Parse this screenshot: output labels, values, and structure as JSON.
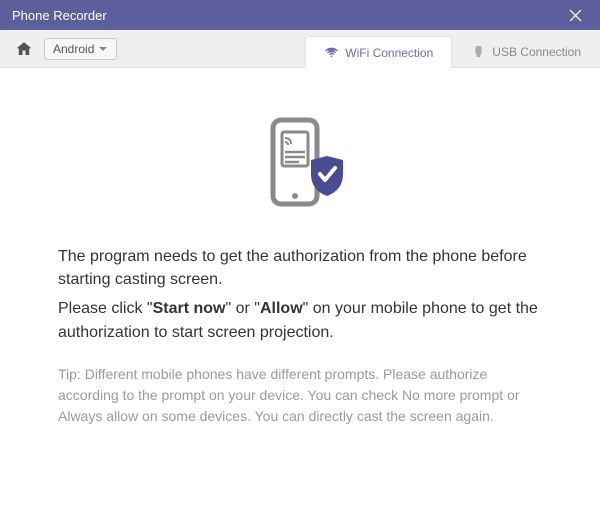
{
  "titlebar": {
    "title": "Phone Recorder"
  },
  "toolbar": {
    "device_label": "Android"
  },
  "tabs": {
    "wifi": "WiFi Connection",
    "usb": "USB Connection"
  },
  "messages": {
    "line1": "The program needs to get the authorization from the phone before starting casting screen.",
    "line2_pre": "Please click \"",
    "line2_b1": "Start now",
    "line2_mid": "\" or \"",
    "line2_b2": "Allow",
    "line2_post": "\" on your mobile phone to get the authorization to start screen projection.",
    "tip": "Tip: Different mobile phones have different prompts. Please authorize according to the prompt on your device. You can check No more prompt or Always allow on some devices. You can directly cast the screen again."
  }
}
